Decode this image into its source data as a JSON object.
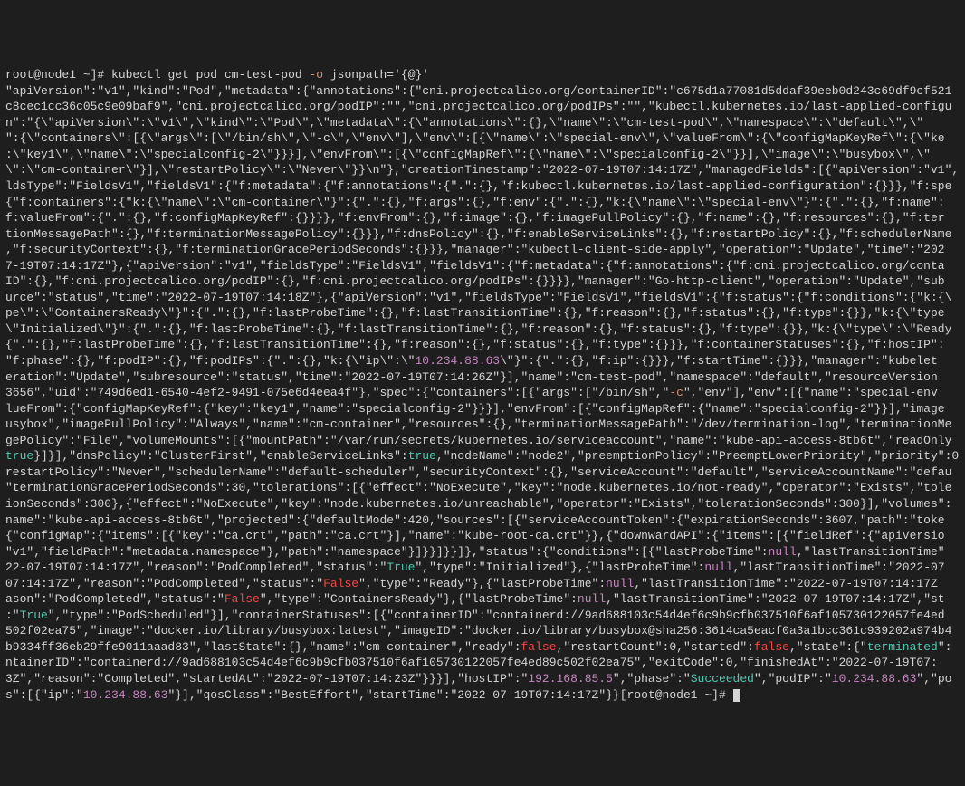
{
  "prompt": "root@node1 ~]# ",
  "command": "kubectl get pod cm-test-pod ",
  "flag": "-o",
  "arg": " jsonpath='{@}'",
  "end_prompt": "[root@node1 ~]# ",
  "ip_a": "10.234.88.63",
  "ip_b": "192.168.85.5",
  "status_succeeded": "Succeeded",
  "t_true": "true",
  "t_True": "True",
  "t_false": "false",
  "t_False": "False",
  "t_null": "null",
  "t_terminated": "terminated",
  "shell_c": "-c",
  "segments": {
    "s01": "\"apiVersion\":\"v1\",\"kind\":\"Pod\",\"metadata\":{\"annotations\":{\"cni.projectcalico.org/containerID\":\"c675d1a77081d5ddaf39eeb0d243c69df9cf521",
    "s02": "c8cec1cc36c05c9e09baf9\",\"cni.projectcalico.org/podIP\":\"\",\"cni.projectcalico.org/podIPs\":\"\",\"kubectl.kubernetes.io/last-applied-configu",
    "s03": "n\":\"{\\\"apiVersion\\\":\\\"v1\\\",\\\"kind\\\":\\\"Pod\\\",\\\"metadata\\\":{\\\"annotations\\\":{},\\\"name\\\":\\\"cm-test-pod\\\",\\\"namespace\\\":\\\"default\\\",\\\"",
    "s04": "\":{\\\"containers\\\":[{\\\"args\\\":[\\\"/bin/sh\\\",\\\"-c\\\",\\\"env\\\"],\\\"env\\\":[{\\\"name\\\":\\\"special-env\\\",\\\"valueFrom\\\":{\\\"configMapKeyRef\\\":{\\\"ke",
    "s05": ":\\\"key1\\\",\\\"name\\\":\\\"specialconfig-2\\\"}}}],\\\"envFrom\\\":[{\\\"configMapRef\\\":{\\\"name\\\":\\\"specialconfig-2\\\"}}],\\\"image\\\":\\\"busybox\\\",\\\"",
    "s06": "\\\":\\\"cm-container\\\"}],\\\"restartPolicy\\\":\\\"Never\\\"}}\\n\"},\"creationTimestamp\":\"2022-07-19T07:14:17Z\",\"managedFields\":[{\"apiVersion\":\"v1\",",
    "s07": "ldsType\":\"FieldsV1\",\"fieldsV1\":{\"f:metadata\":{\"f:annotations\":{\".\":{},\"f:kubectl.kubernetes.io/last-applied-configuration\":{}}},\"f:spe",
    "s08": "{\"f:containers\":{\"k:{\\\"name\\\":\\\"cm-container\\\"}\":{\".\":{},\"f:args\":{},\"f:env\":{\".\":{},\"k:{\\\"name\\\":\\\"special-env\\\"}\":{\".\":{},\"f:name\":",
    "s09": "f:valueFrom\":{\".\":{},\"f:configMapKeyRef\":{}}}},\"f:envFrom\":{},\"f:image\":{},\"f:imagePullPolicy\":{},\"f:name\":{},\"f:resources\":{},\"f:ter",
    "s10": "tionMessagePath\":{},\"f:terminationMessagePolicy\":{}}},\"f:dnsPolicy\":{},\"f:enableServiceLinks\":{},\"f:restartPolicy\":{},\"f:schedulerName",
    "s11": ",\"f:securityContext\":{},\"f:terminationGracePeriodSeconds\":{}}},\"manager\":\"kubectl-client-side-apply\",\"operation\":\"Update\",\"time\":\"202",
    "s12": "7-19T07:14:17Z\"},{\"apiVersion\":\"v1\",\"fieldsType\":\"FieldsV1\",\"fieldsV1\":{\"f:metadata\":{\"f:annotations\":{\"f:cni.projectcalico.org/conta",
    "s13": "ID\":{},\"f:cni.projectcalico.org/podIP\":{},\"f:cni.projectcalico.org/podIPs\":{}}}},\"manager\":\"Go-http-client\",\"operation\":\"Update\",\"sub",
    "s14": "urce\":\"status\",\"time\":\"2022-07-19T07:14:18Z\"},{\"apiVersion\":\"v1\",\"fieldsType\":\"FieldsV1\",\"fieldsV1\":{\"f:status\":{\"f:conditions\":{\"k:{\\",
    "s15": "pe\\\":\\\"ContainersReady\\\"}\":{\".\":{},\"f:lastProbeTime\":{},\"f:lastTransitionTime\":{},\"f:reason\":{},\"f:status\":{},\"f:type\":{}},\"k:{\\\"type",
    "s16": "\\\"Initialized\\\"}\":{\".\":{},\"f:lastProbeTime\":{},\"f:lastTransitionTime\":{},\"f:reason\":{},\"f:status\":{},\"f:type\":{}},\"k:{\\\"type\\\":\\\"Ready",
    "s17": "{\".\":{},\"f:lastProbeTime\":{},\"f:lastTransitionTime\":{},\"f:reason\":{},\"f:status\":{},\"f:type\":{}}},\"f:containerStatuses\":{},\"f:hostIP\":",
    "s18a": "\"f:phase\":{},\"f:podIP\":{},\"f:podIPs\":{\".\":{},\"k:{\\\"ip\\\":\\\"",
    "s18b": "\\\"}\":{\".\":{},\"f:ip\":{}}},\"f:startTime\":{}}},\"manager\":\"kubelet",
    "s19": "eration\":\"Update\",\"subresource\":\"status\",\"time\":\"2022-07-19T07:14:26Z\"}],\"name\":\"cm-test-pod\",\"namespace\":\"default\",\"resourceVersion",
    "s20a": "3656\",\"uid\":\"749d6ed1-6540-4ef2-9491-075e6d4eea4f\"},\"spec\":{\"containers\":[{\"args\":[\"/bin/sh\",\"",
    "s20b": "\",\"env\"],\"env\":[{\"name\":\"special-env",
    "s21": "lueFrom\":{\"configMapKeyRef\":{\"key\":\"key1\",\"name\":\"specialconfig-2\"}}}],\"envFrom\":[{\"configMapRef\":{\"name\":\"specialconfig-2\"}}],\"image",
    "s22": "usybox\",\"imagePullPolicy\":\"Always\",\"name\":\"cm-container\",\"resources\":{},\"terminationMessagePath\":\"/dev/termination-log\",\"terminationMe",
    "s23": "gePolicy\":\"File\",\"volumeMounts\":[{\"mountPath\":\"/var/run/secrets/kubernetes.io/serviceaccount\",\"name\":\"kube-api-access-8tb6t\",\"readOnly",
    "s24a": "}]}],\"dnsPolicy\":\"ClusterFirst\",\"enableServiceLinks\":",
    "s24b": ",\"nodeName\":\"node2\",\"preemptionPolicy\":\"PreemptLowerPriority\",\"priority\":0",
    "s25": "restartPolicy\":\"Never\",\"schedulerName\":\"default-scheduler\",\"securityContext\":{},\"serviceAccount\":\"default\",\"serviceAccountName\":\"defau",
    "s26": "\"terminationGracePeriodSeconds\":30,\"tolerations\":[{\"effect\":\"NoExecute\",\"key\":\"node.kubernetes.io/not-ready\",\"operator\":\"Exists\",\"tole",
    "s27": "ionSeconds\":300},{\"effect\":\"NoExecute\",\"key\":\"node.kubernetes.io/unreachable\",\"operator\":\"Exists\",\"tolerationSeconds\":300}],\"volumes\":",
    "s28": "name\":\"kube-api-access-8tb6t\",\"projected\":{\"defaultMode\":420,\"sources\":[{\"serviceAccountToken\":{\"expirationSeconds\":3607,\"path\":\"toke",
    "s29": "{\"configMap\":{\"items\":[{\"key\":\"ca.crt\",\"path\":\"ca.crt\"}],\"name\":\"kube-root-ca.crt\"}},{\"downwardAPI\":{\"items\":[{\"fieldRef\":{\"apiVersio",
    "s30a": "\"v1\",\"fieldPath\":\"metadata.namespace\"},\"path\":\"namespace\"}]}}]}}]},\"status\":{\"conditions\":[{\"lastProbeTime\":",
    "s30b": ",\"lastTransitionTime\"",
    "s31a": "22-07-19T07:14:17Z\",\"reason\":\"PodCompleted\",\"status\":\"",
    "s31b": "\",\"type\":\"Initialized\"},{\"lastProbeTime\":",
    "s31c": ",\"lastTransitionTime\":\"2022-07",
    "s32a": "07:14:17Z\",\"reason\":\"PodCompleted\",\"status\":\"",
    "s32b": "\",\"type\":\"Ready\"},{\"lastProbeTime\":",
    "s32c": ",\"lastTransitionTime\":\"2022-07-19T07:14:17Z",
    "s33a": "ason\":\"PodCompleted\",\"status\":\"",
    "s33b": "\",\"type\":\"ContainersReady\"},{\"lastProbeTime\":",
    "s33c": ",\"lastTransitionTime\":\"2022-07-19T07:14:17Z\",\"st",
    "s34a": ":\"",
    "s34b": "\",\"type\":\"PodScheduled\"}],\"containerStatuses\":[{\"containerID\":\"containerd://9ad688103c54d4ef6c9b9cfb037510f6af105730122057fe4ed",
    "s35a": "502f02ea75\",\"image\":\"docker.io/library/busybox:latest\",\"imageID\":\"docker.io/library/busybox@sha256:3614ca5eacf0a3a1bcc361c939202a974b4",
    "s36a": "b9334ff36eb29ffe9011aaad83\",\"lastState\":{},\"name\":\"cm-container\",\"ready\":",
    "s36b": ",\"restartCount\":0,\"started\":",
    "s36c": ",\"state\":{\"",
    "s36d": "\":",
    "s37a": "ntainerID\":\"containerd://9ad688103c54d4ef6c9b9cfb037510f6af105730122057fe4ed89c502f02ea75\",\"exitCode\":0,\"finishedAt\":\"2022-07-19T07:",
    "s38a": "3Z\",\"reason\":\"Completed\",\"startedAt\":\"2022-07-19T07:14:23Z\"}}}],\"hostIP\":\"",
    "s38b": "\",\"phase\":\"",
    "s38c": "\",\"podIP\":\"",
    "s38d": "\",\"po",
    "s39a": "s\":[{\"ip\":\"",
    "s39b": "\"}],\"qosClass\":\"BestEffort\",\"startTime\":\"2022-07-19T07:14:17Z\"}}"
  }
}
